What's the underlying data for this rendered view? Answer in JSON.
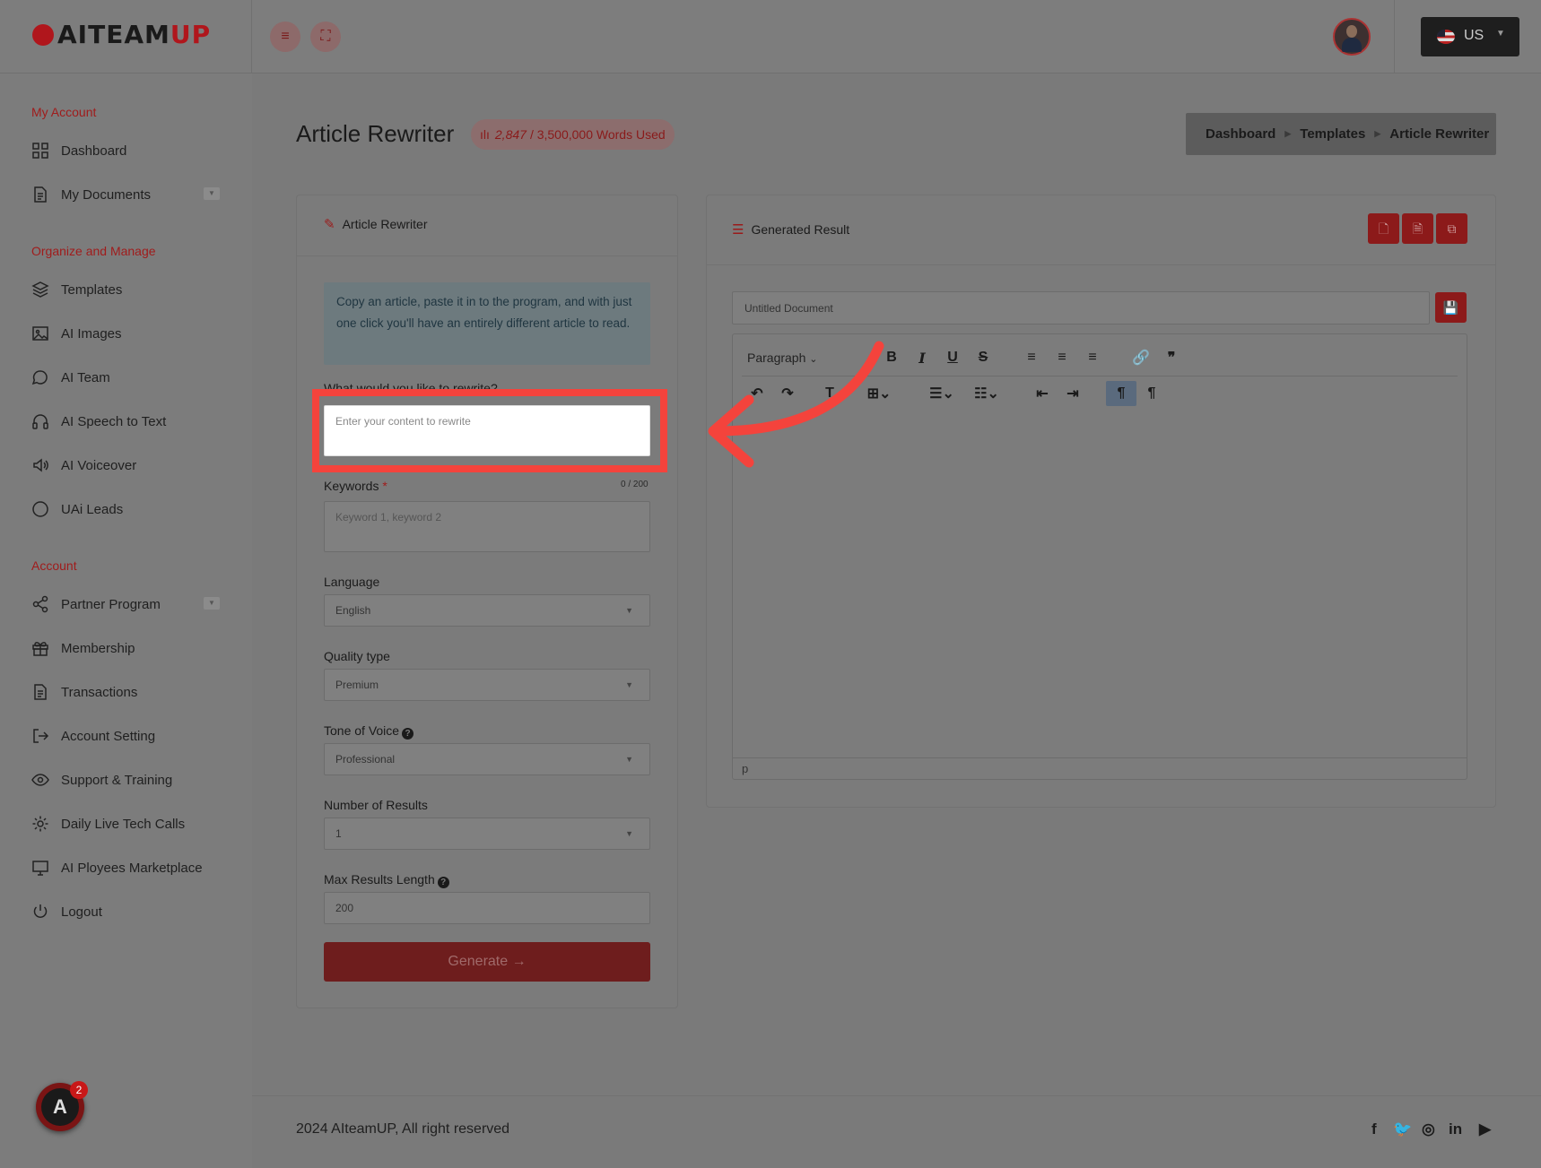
{
  "brand": {
    "name_main": "AITEAM",
    "name_accent": "UP"
  },
  "header": {
    "language": "US"
  },
  "sidebar": {
    "sections": [
      {
        "title": "My Account",
        "items": [
          {
            "label": "Dashboard"
          },
          {
            "label": "My Documents"
          }
        ]
      },
      {
        "title": "Organize and Manage",
        "items": [
          {
            "label": "Templates"
          },
          {
            "label": "AI Images"
          },
          {
            "label": "AI Team"
          },
          {
            "label": "AI Speech to Text"
          },
          {
            "label": "AI Voiceover"
          },
          {
            "label": "UAi Leads"
          }
        ]
      },
      {
        "title": "Account",
        "items": [
          {
            "label": "Partner Program"
          },
          {
            "label": "Membership"
          },
          {
            "label": "Transactions"
          },
          {
            "label": "Account Setting"
          },
          {
            "label": "Support & Training"
          },
          {
            "label": "Daily Live Tech Calls"
          },
          {
            "label": "AI Ployees Marketplace"
          },
          {
            "label": "Logout"
          }
        ]
      }
    ],
    "fab_badge": "2"
  },
  "page": {
    "title": "Article Rewriter",
    "words_used": "2,847",
    "words_total": "/ 3,500,000 Words Used",
    "breadcrumb": [
      "Dashboard",
      "Templates",
      "Article Rewriter"
    ]
  },
  "form": {
    "card_title": "Article Rewriter",
    "info": "Copy an article, paste it in to the program, and with just one click you'll have an entirely different article to read.",
    "content_label": "What would you like to rewrite?",
    "content_placeholder": "Enter your content to rewrite",
    "keywords_label": "Keywords",
    "keywords_counter": "0 / 200",
    "keywords_placeholder": "Keyword 1, keyword 2",
    "language_label": "Language",
    "language_value": "English",
    "quality_label": "Quality type",
    "quality_value": "Premium",
    "tone_label": "Tone of Voice",
    "tone_value": "Professional",
    "results_label": "Number of Results",
    "results_value": "1",
    "maxlen_label": "Max Results Length",
    "maxlen_value": "200",
    "generate_label": "Generate →"
  },
  "result": {
    "card_title": "Generated Result",
    "doc_title_placeholder": "Untitled Document",
    "paragraph_style": "Paragraph",
    "status_path": "p"
  },
  "footer": {
    "copyright": "2024 AIteamUP, All right reserved"
  },
  "colors": {
    "accent": "#a01c1c",
    "highlight": "#f4433c"
  }
}
